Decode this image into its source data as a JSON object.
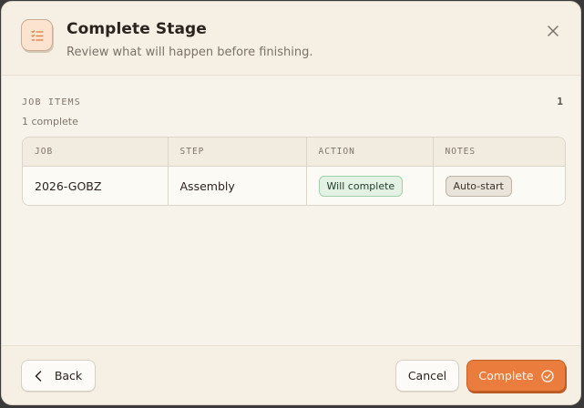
{
  "dialog": {
    "title": "Complete Stage",
    "subtitle": "Review what will happen before finishing.",
    "header_icon": "checklist-icon",
    "close_icon": "close-icon"
  },
  "section": {
    "label": "JOB ITEMS",
    "count": "1",
    "summary": "1 complete"
  },
  "table": {
    "columns": [
      "JOB",
      "STEP",
      "ACTION",
      "NOTES"
    ],
    "rows": [
      {
        "job": "2026-GOBZ",
        "step": "Assembly",
        "action": "Will complete",
        "notes": "Auto-start"
      }
    ]
  },
  "footer": {
    "back_label": "Back",
    "cancel_label": "Cancel",
    "complete_label": "Complete",
    "back_icon": "chevron-left-icon",
    "complete_icon": "check-circle-icon"
  },
  "colors": {
    "accent": "#ea7d3d",
    "action_badge_bg": "#e4f2e6",
    "notes_badge_bg": "#e9e3da",
    "background": "#f8f3ea"
  }
}
